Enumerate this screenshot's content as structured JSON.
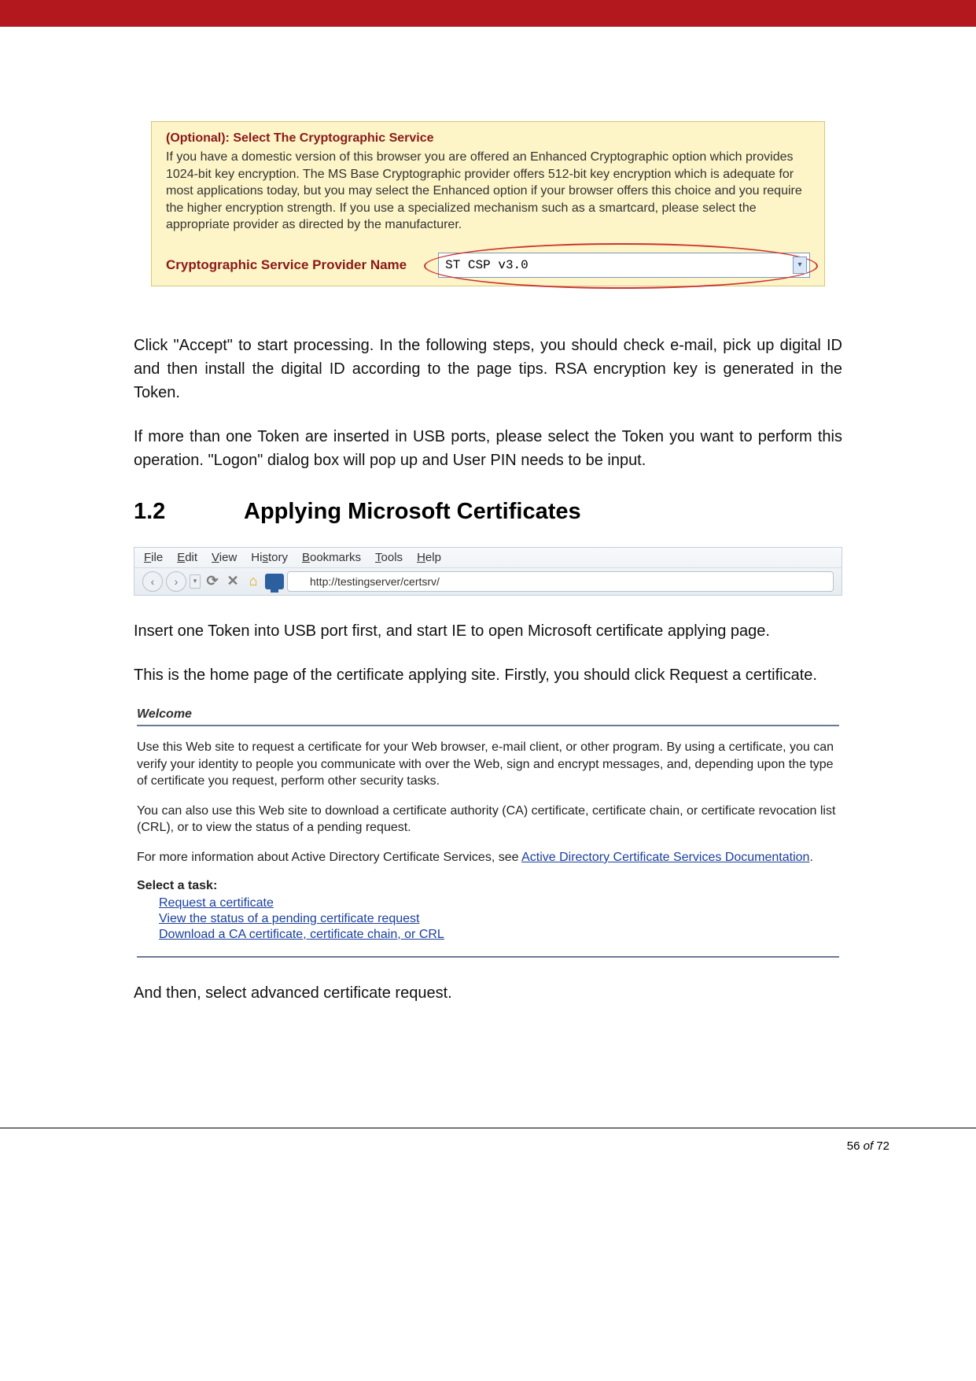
{
  "crypto_panel": {
    "heading": "(Optional): Select The Cryptographic Service",
    "body": "If you have a domestic version of this browser you are offered an Enhanced Cryptographic option which provides 1024-bit key encryption. The MS Base Cryptographic provider offers 512-bit key encryption which is adequate for most applications today, but you may select the Enhanced option if your browser offers this choice and you require the higher encryption strength. If you use a specialized mechanism such as a smartcard, please select the appropriate provider as directed by the manufacturer.",
    "label": "Cryptographic Service Provider Name",
    "select_value": "ST CSP v3.0"
  },
  "paragraphs": {
    "p1": "Click \"Accept\" to start processing. In the following steps, you should check e-mail, pick up digital ID and then install the digital ID according to the page tips. RSA encryption key is generated in the Token.",
    "p2": "If more than one Token are inserted in USB ports, please select the Token you want to perform this operation. \"Logon\" dialog box will pop up and User PIN needs to be input.",
    "p3": "Insert one Token into USB port first, and start IE to open Microsoft certificate applying page.",
    "p4": "This is the home page of the certificate applying site. Firstly, you should click Request a certificate.",
    "p5": "And then, select advanced certificate request."
  },
  "section": {
    "number": "1.2",
    "title": "Applying Microsoft Certificates"
  },
  "browser": {
    "menu": {
      "file": "File",
      "edit": "Edit",
      "view": "View",
      "history": "History",
      "bookmarks": "Bookmarks",
      "tools": "Tools",
      "help": "Help"
    },
    "url": "http://testingserver/certsrv/"
  },
  "welcome": {
    "title": "Welcome",
    "p1": "Use this Web site to request a certificate for your Web browser, e-mail client, or other program. By using a certificate, you can verify your identity to people you communicate with over the Web, sign and encrypt messages, and, depending upon the type of certificate you request, perform other security tasks.",
    "p2": "You can also use this Web site to download a certificate authority (CA) certificate, certificate chain, or certificate revocation list (CRL), or to view the status of a pending request.",
    "p3_a": "For more information about Active Directory Certificate Services, see ",
    "p3_link": "Active Directory Certificate Services Documentation",
    "p3_b": ".",
    "task_label": "Select a task:",
    "tasks": {
      "t1": "Request a certificate",
      "t2": "View the status of a pending certificate request",
      "t3": "Download a CA certificate, certificate chain, or CRL"
    }
  },
  "footer": {
    "page": "56",
    "of": "of",
    "total": "72"
  }
}
